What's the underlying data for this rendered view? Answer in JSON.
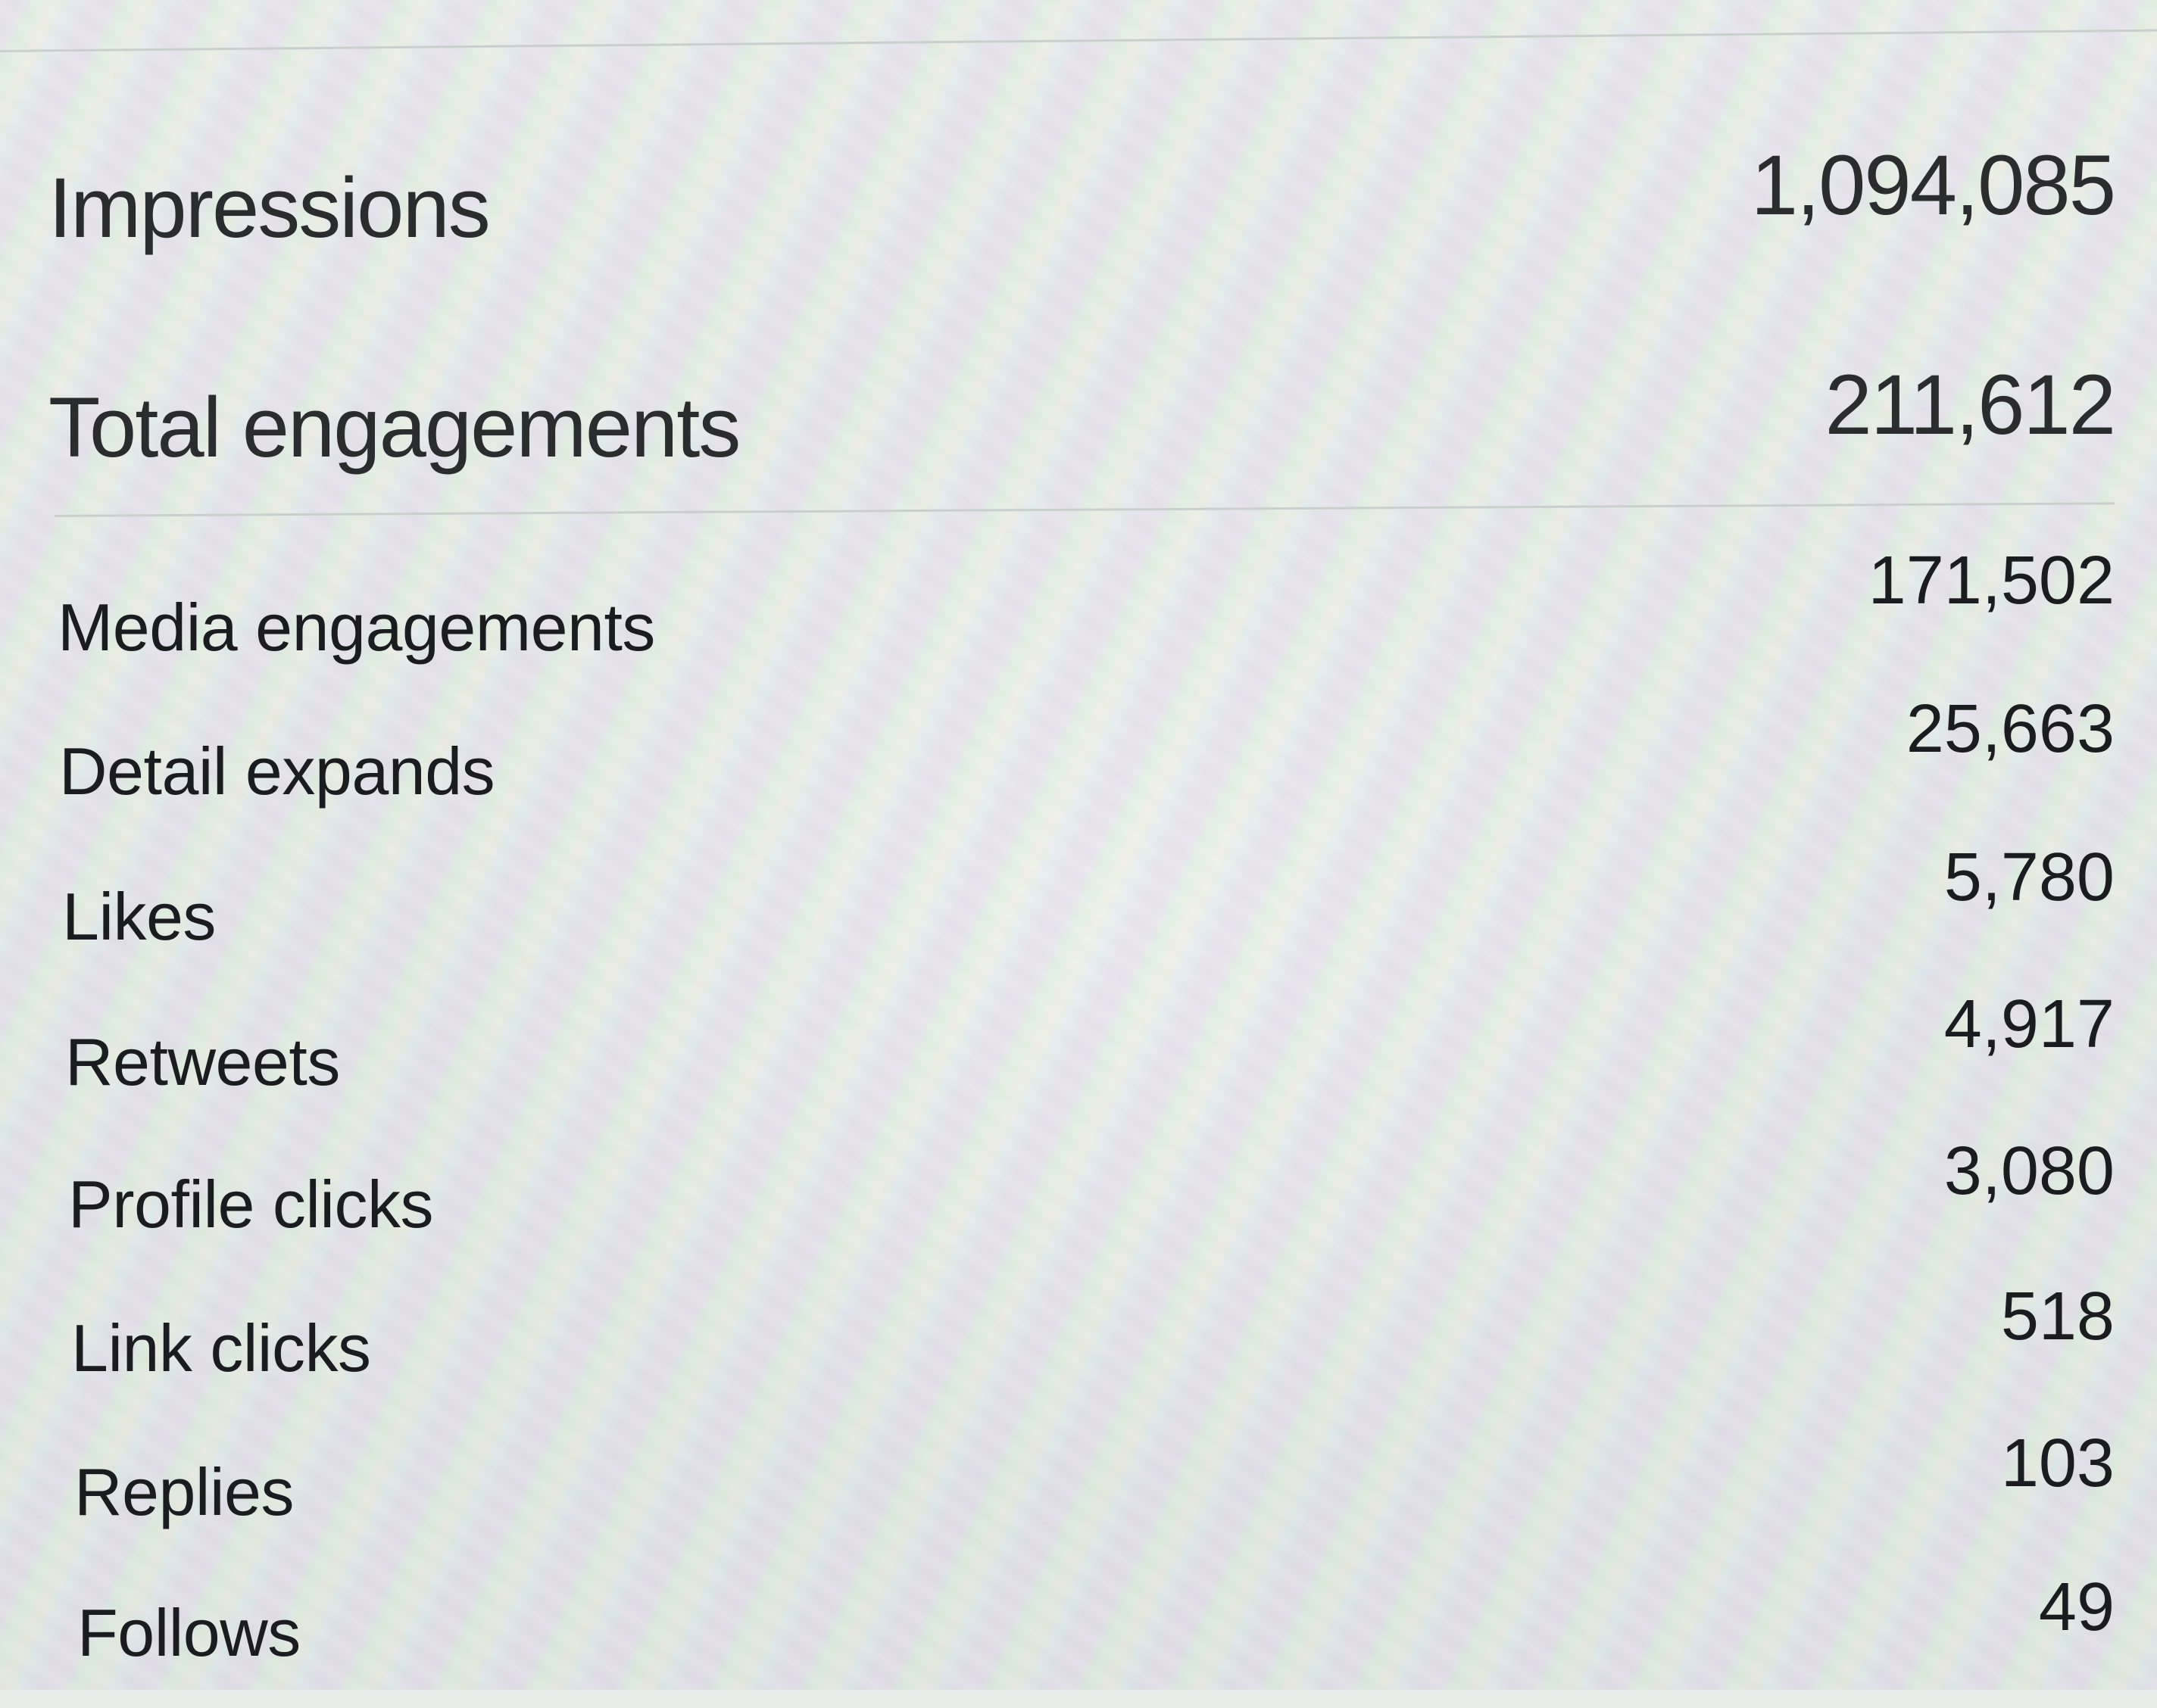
{
  "summary": {
    "impressions": {
      "label": "Impressions",
      "value": "1,094,085"
    },
    "total_engagements": {
      "label": "Total engagements",
      "value": "211,612"
    }
  },
  "metrics": [
    {
      "label": "Media engagements",
      "value": "171,502"
    },
    {
      "label": "Detail expands",
      "value": "25,663"
    },
    {
      "label": "Likes",
      "value": "5,780"
    },
    {
      "label": "Retweets",
      "value": "4,917"
    },
    {
      "label": "Profile clicks",
      "value": "3,080"
    },
    {
      "label": "Link clicks",
      "value": "518"
    },
    {
      "label": "Replies",
      "value": "103"
    },
    {
      "label": "Follows",
      "value": "49"
    }
  ],
  "colors": {
    "text_primary": "#1b1c1f",
    "text_summary": "#2a2c2e",
    "divider": "#c9cfcc",
    "background": "#e7ece9"
  }
}
